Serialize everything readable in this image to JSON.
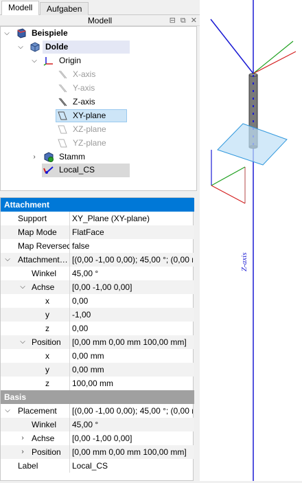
{
  "tabs": [
    {
      "label": "Modell",
      "active": true
    },
    {
      "label": "Aufgaben",
      "active": false
    }
  ],
  "panel": {
    "title": "Modell",
    "btn_float": "⊟",
    "btn_restore": "⧉",
    "btn_close": "✕"
  },
  "tree": {
    "items": [
      {
        "label": "Beispiele",
        "icon": "document-icon"
      },
      {
        "label": "Dolde",
        "icon": "body-icon"
      },
      {
        "label": "Origin",
        "icon": "origin-icon"
      },
      {
        "label": "X-axis",
        "icon": "axis-icon"
      },
      {
        "label": "Y-axis",
        "icon": "axis-icon"
      },
      {
        "label": "Z-axis",
        "icon": "axis-icon"
      },
      {
        "label": "XY-plane",
        "icon": "plane-icon"
      },
      {
        "label": "XZ-plane",
        "icon": "plane-icon"
      },
      {
        "label": "YZ-plane",
        "icon": "plane-icon"
      },
      {
        "label": "Stamm",
        "icon": "pad-icon"
      },
      {
        "label": "Local_CS",
        "icon": "local-cs-icon"
      }
    ]
  },
  "view": {
    "axis_label": "Z-axis"
  },
  "properties": {
    "group_attachment": "Attachment",
    "group_basis": "Basis",
    "rows": [
      {
        "name": "Support",
        "value": "XY_Plane (XY-plane)"
      },
      {
        "name": "Map Mode",
        "value": "FlatFace"
      },
      {
        "name": "Map Reversed",
        "value": "false"
      },
      {
        "name": "Attachment…",
        "value": "[(0,00 -1,00 0,00); 45,00 °; (0,00 m"
      },
      {
        "name": "Winkel",
        "value": "45,00 °"
      },
      {
        "name": "Achse",
        "value": "[0,00 -1,00 0,00]"
      },
      {
        "name": "x",
        "value": "0,00"
      },
      {
        "name": "y",
        "value": "-1,00"
      },
      {
        "name": "z",
        "value": "0,00"
      },
      {
        "name": "Position",
        "value": "[0,00 mm  0,00 mm  100,00 mm]"
      },
      {
        "name": "x",
        "value": "0,00 mm"
      },
      {
        "name": "y",
        "value": "0,00 mm"
      },
      {
        "name": "z",
        "value": "100,00 mm"
      },
      {
        "name": "Placement",
        "value": "[(0,00 -1,00 0,00); 45,00 °; (0,00 m"
      },
      {
        "name": "Winkel",
        "value": "45,00 °"
      },
      {
        "name": "Achse",
        "value": "[0,00 -1,00 0,00]"
      },
      {
        "name": "Position",
        "value": "[0,00 mm  0,00 mm  100,00 mm]"
      },
      {
        "name": "Label",
        "value": "Local_CS"
      }
    ]
  },
  "colors": {
    "selection_blue": "#0078d7",
    "x_axis": "#d42020",
    "y_axis": "#20a020",
    "z_axis": "#1a1ad4"
  }
}
